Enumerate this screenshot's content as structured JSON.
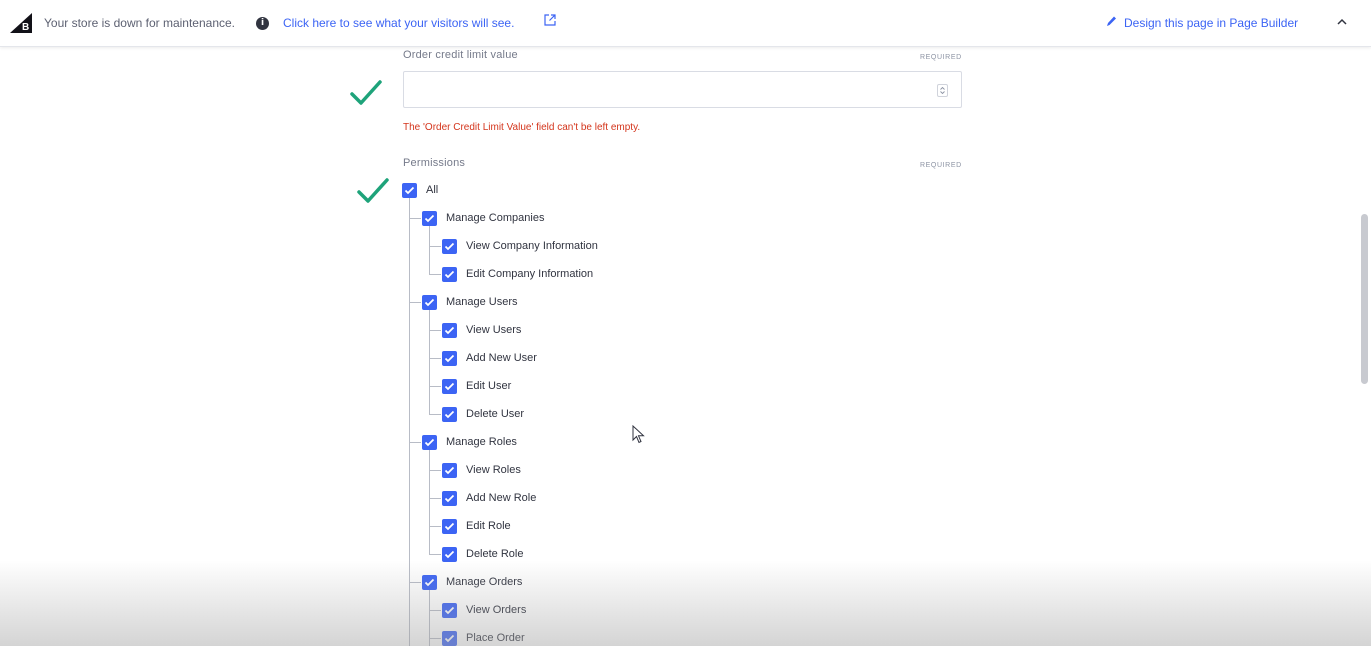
{
  "banner": {
    "message": "Your store is down for maintenance.",
    "visitors_link": "Click here to see what your visitors will see.",
    "page_builder_link": "Design this page in Page Builder"
  },
  "credit_limit": {
    "label": "Order credit limit value",
    "required": "REQUIRED",
    "value": "",
    "error": "The 'Order Credit Limit Value' field can't be left empty."
  },
  "permissions": {
    "label": "Permissions",
    "required": "REQUIRED",
    "all_label": "All",
    "groups": [
      {
        "label": "Manage Companies",
        "items": [
          "View Company Information",
          "Edit Company Information"
        ]
      },
      {
        "label": "Manage Users",
        "items": [
          "View Users",
          "Add New User",
          "Edit User",
          "Delete User"
        ]
      },
      {
        "label": "Manage Roles",
        "items": [
          "View Roles",
          "Add New Role",
          "Edit Role",
          "Delete Role"
        ]
      },
      {
        "label": "Manage Orders",
        "items": [
          "View Orders",
          "Place Order"
        ]
      }
    ]
  },
  "colors": {
    "accent": "#3c64f4",
    "check_green": "#1ea37a",
    "error": "#d4351c"
  }
}
